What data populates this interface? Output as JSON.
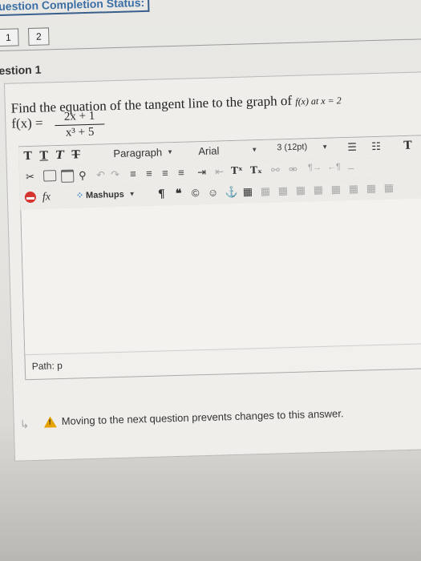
{
  "header": {
    "status_label": "uestion Completion Status:",
    "question_numbers": [
      "1",
      "2"
    ],
    "question_title": "estion 1"
  },
  "question": {
    "prompt_main": "Find the equation of the tangent line to the graph of",
    "prompt_tail": "f(x) at x = 2",
    "function_lhs": "f(x) =",
    "numerator": "2x + 1",
    "denominator": "x³ + 5"
  },
  "toolbar": {
    "row1": {
      "t1": "T",
      "t2": "T",
      "t3": "T",
      "t4": "T",
      "paragraph": "Paragraph",
      "font": "Arial",
      "size": "3 (12pt)"
    },
    "row3": {
      "fx": "fx",
      "mashups": "Mashups",
      "pilcrow": "¶",
      "quote": "❝",
      "copyright": "©"
    }
  },
  "editor": {
    "path_label": "Path: p"
  },
  "footer": {
    "warning": "Moving to the next question prevents changes to this answer."
  },
  "colors": {
    "warning_triangle": "#e4a300",
    "status_border": "#3a5f8c",
    "status_text": "#3a6ea5"
  }
}
